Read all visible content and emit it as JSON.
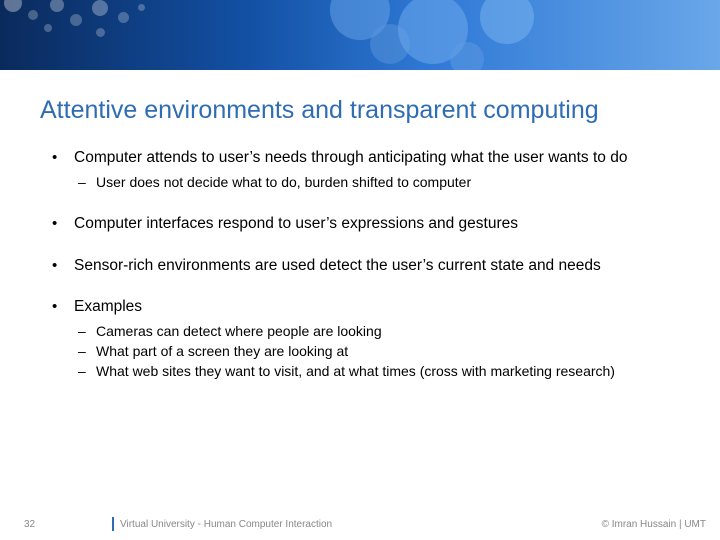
{
  "title": "Attentive environments and transparent computing",
  "bullets": [
    {
      "text": "Computer attends to user’s needs through anticipating what the user wants to do",
      "sub": [
        "User does not decide what to do, burden shifted to computer"
      ]
    },
    {
      "text": "Computer interfaces respond to user’s expressions and gestures",
      "sub": []
    },
    {
      "text": "Sensor-rich environments are used detect the user’s current state and needs",
      "sub": []
    },
    {
      "text": "Examples",
      "sub": [
        "Cameras can detect where people are looking",
        "What part of a screen they are looking at",
        "What web sites they want to visit, and at what times (cross with marketing research)"
      ]
    }
  ],
  "footer": {
    "page": "32",
    "center": "Virtual University - Human Computer Interaction",
    "right": "© Imran Hussain | UMT"
  }
}
